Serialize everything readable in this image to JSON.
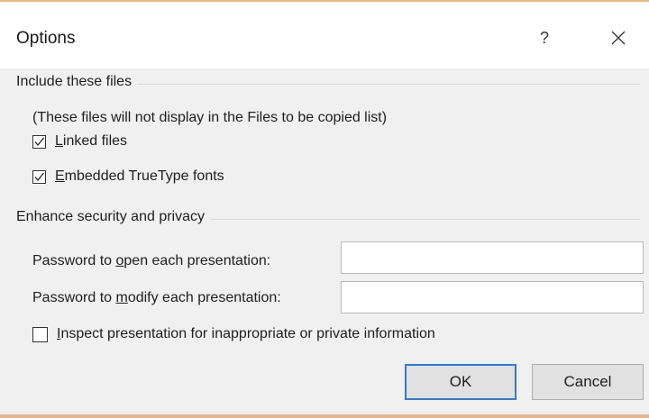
{
  "dialog": {
    "title": "Options",
    "help_label": "?",
    "close_icon": "close-icon"
  },
  "include_files": {
    "group_label": "Include these files",
    "note": "(These files will not display in the Files to be copied list)",
    "linked_files": {
      "pre": "",
      "mnemonic": "L",
      "post": "inked files",
      "checked": true
    },
    "embedded_fonts": {
      "pre": "",
      "mnemonic": "E",
      "post": "mbedded TrueType fonts",
      "checked": true
    }
  },
  "security": {
    "group_label": "Enhance security and privacy",
    "open_password": {
      "pre": "Password to ",
      "mnemonic": "o",
      "post": "pen each presentation:",
      "value": ""
    },
    "modify_password": {
      "pre": "Password to ",
      "mnemonic": "m",
      "post": "odify each presentation:",
      "value": ""
    },
    "inspect": {
      "pre": "",
      "mnemonic": "I",
      "post": "nspect presentation for inappropriate or private information",
      "checked": false
    }
  },
  "buttons": {
    "ok": "OK",
    "cancel": "Cancel"
  },
  "colors": {
    "accent_border": "#e8b48a",
    "default_button_border": "#2f7ad8",
    "client_background": "#f0f0f0"
  }
}
